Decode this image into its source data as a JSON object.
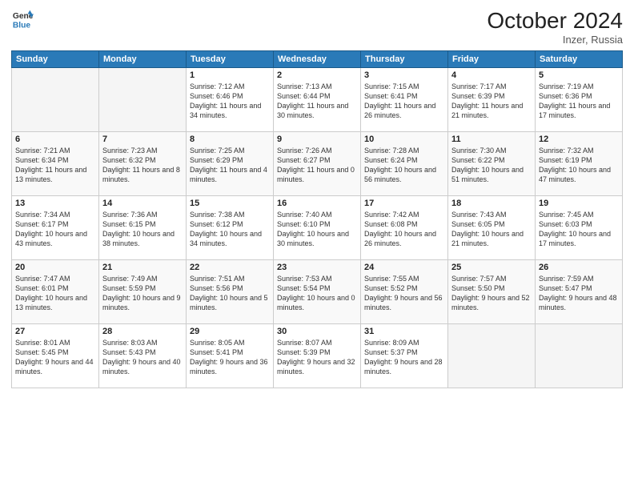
{
  "header": {
    "logo_line1": "General",
    "logo_line2": "Blue",
    "month_title": "October 2024",
    "location": "Inzer, Russia"
  },
  "weekdays": [
    "Sunday",
    "Monday",
    "Tuesday",
    "Wednesday",
    "Thursday",
    "Friday",
    "Saturday"
  ],
  "weeks": [
    [
      {
        "day": "",
        "sunrise": "",
        "sunset": "",
        "daylight": ""
      },
      {
        "day": "",
        "sunrise": "",
        "sunset": "",
        "daylight": ""
      },
      {
        "day": "1",
        "sunrise": "Sunrise: 7:12 AM",
        "sunset": "Sunset: 6:46 PM",
        "daylight": "Daylight: 11 hours and 34 minutes."
      },
      {
        "day": "2",
        "sunrise": "Sunrise: 7:13 AM",
        "sunset": "Sunset: 6:44 PM",
        "daylight": "Daylight: 11 hours and 30 minutes."
      },
      {
        "day": "3",
        "sunrise": "Sunrise: 7:15 AM",
        "sunset": "Sunset: 6:41 PM",
        "daylight": "Daylight: 11 hours and 26 minutes."
      },
      {
        "day": "4",
        "sunrise": "Sunrise: 7:17 AM",
        "sunset": "Sunset: 6:39 PM",
        "daylight": "Daylight: 11 hours and 21 minutes."
      },
      {
        "day": "5",
        "sunrise": "Sunrise: 7:19 AM",
        "sunset": "Sunset: 6:36 PM",
        "daylight": "Daylight: 11 hours and 17 minutes."
      }
    ],
    [
      {
        "day": "6",
        "sunrise": "Sunrise: 7:21 AM",
        "sunset": "Sunset: 6:34 PM",
        "daylight": "Daylight: 11 hours and 13 minutes."
      },
      {
        "day": "7",
        "sunrise": "Sunrise: 7:23 AM",
        "sunset": "Sunset: 6:32 PM",
        "daylight": "Daylight: 11 hours and 8 minutes."
      },
      {
        "day": "8",
        "sunrise": "Sunrise: 7:25 AM",
        "sunset": "Sunset: 6:29 PM",
        "daylight": "Daylight: 11 hours and 4 minutes."
      },
      {
        "day": "9",
        "sunrise": "Sunrise: 7:26 AM",
        "sunset": "Sunset: 6:27 PM",
        "daylight": "Daylight: 11 hours and 0 minutes."
      },
      {
        "day": "10",
        "sunrise": "Sunrise: 7:28 AM",
        "sunset": "Sunset: 6:24 PM",
        "daylight": "Daylight: 10 hours and 56 minutes."
      },
      {
        "day": "11",
        "sunrise": "Sunrise: 7:30 AM",
        "sunset": "Sunset: 6:22 PM",
        "daylight": "Daylight: 10 hours and 51 minutes."
      },
      {
        "day": "12",
        "sunrise": "Sunrise: 7:32 AM",
        "sunset": "Sunset: 6:19 PM",
        "daylight": "Daylight: 10 hours and 47 minutes."
      }
    ],
    [
      {
        "day": "13",
        "sunrise": "Sunrise: 7:34 AM",
        "sunset": "Sunset: 6:17 PM",
        "daylight": "Daylight: 10 hours and 43 minutes."
      },
      {
        "day": "14",
        "sunrise": "Sunrise: 7:36 AM",
        "sunset": "Sunset: 6:15 PM",
        "daylight": "Daylight: 10 hours and 38 minutes."
      },
      {
        "day": "15",
        "sunrise": "Sunrise: 7:38 AM",
        "sunset": "Sunset: 6:12 PM",
        "daylight": "Daylight: 10 hours and 34 minutes."
      },
      {
        "day": "16",
        "sunrise": "Sunrise: 7:40 AM",
        "sunset": "Sunset: 6:10 PM",
        "daylight": "Daylight: 10 hours and 30 minutes."
      },
      {
        "day": "17",
        "sunrise": "Sunrise: 7:42 AM",
        "sunset": "Sunset: 6:08 PM",
        "daylight": "Daylight: 10 hours and 26 minutes."
      },
      {
        "day": "18",
        "sunrise": "Sunrise: 7:43 AM",
        "sunset": "Sunset: 6:05 PM",
        "daylight": "Daylight: 10 hours and 21 minutes."
      },
      {
        "day": "19",
        "sunrise": "Sunrise: 7:45 AM",
        "sunset": "Sunset: 6:03 PM",
        "daylight": "Daylight: 10 hours and 17 minutes."
      }
    ],
    [
      {
        "day": "20",
        "sunrise": "Sunrise: 7:47 AM",
        "sunset": "Sunset: 6:01 PM",
        "daylight": "Daylight: 10 hours and 13 minutes."
      },
      {
        "day": "21",
        "sunrise": "Sunrise: 7:49 AM",
        "sunset": "Sunset: 5:59 PM",
        "daylight": "Daylight: 10 hours and 9 minutes."
      },
      {
        "day": "22",
        "sunrise": "Sunrise: 7:51 AM",
        "sunset": "Sunset: 5:56 PM",
        "daylight": "Daylight: 10 hours and 5 minutes."
      },
      {
        "day": "23",
        "sunrise": "Sunrise: 7:53 AM",
        "sunset": "Sunset: 5:54 PM",
        "daylight": "Daylight: 10 hours and 0 minutes."
      },
      {
        "day": "24",
        "sunrise": "Sunrise: 7:55 AM",
        "sunset": "Sunset: 5:52 PM",
        "daylight": "Daylight: 9 hours and 56 minutes."
      },
      {
        "day": "25",
        "sunrise": "Sunrise: 7:57 AM",
        "sunset": "Sunset: 5:50 PM",
        "daylight": "Daylight: 9 hours and 52 minutes."
      },
      {
        "day": "26",
        "sunrise": "Sunrise: 7:59 AM",
        "sunset": "Sunset: 5:47 PM",
        "daylight": "Daylight: 9 hours and 48 minutes."
      }
    ],
    [
      {
        "day": "27",
        "sunrise": "Sunrise: 8:01 AM",
        "sunset": "Sunset: 5:45 PM",
        "daylight": "Daylight: 9 hours and 44 minutes."
      },
      {
        "day": "28",
        "sunrise": "Sunrise: 8:03 AM",
        "sunset": "Sunset: 5:43 PM",
        "daylight": "Daylight: 9 hours and 40 minutes."
      },
      {
        "day": "29",
        "sunrise": "Sunrise: 8:05 AM",
        "sunset": "Sunset: 5:41 PM",
        "daylight": "Daylight: 9 hours and 36 minutes."
      },
      {
        "day": "30",
        "sunrise": "Sunrise: 8:07 AM",
        "sunset": "Sunset: 5:39 PM",
        "daylight": "Daylight: 9 hours and 32 minutes."
      },
      {
        "day": "31",
        "sunrise": "Sunrise: 8:09 AM",
        "sunset": "Sunset: 5:37 PM",
        "daylight": "Daylight: 9 hours and 28 minutes."
      },
      {
        "day": "",
        "sunrise": "",
        "sunset": "",
        "daylight": ""
      },
      {
        "day": "",
        "sunrise": "",
        "sunset": "",
        "daylight": ""
      }
    ]
  ]
}
